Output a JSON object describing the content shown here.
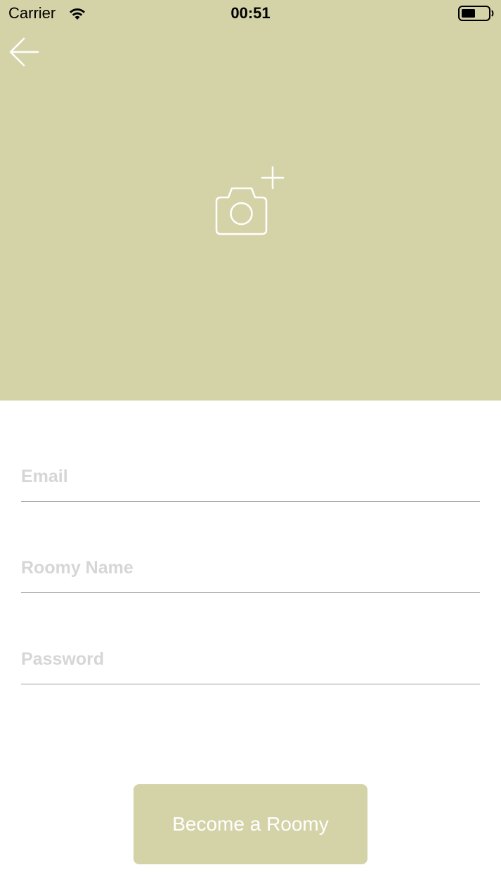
{
  "status_bar": {
    "carrier": "Carrier",
    "time": "00:51",
    "wifi_icon": "wifi-icon",
    "battery_icon": "battery-icon"
  },
  "header": {
    "background_color": "#d4d3a8",
    "back_icon": "arrow-left-icon",
    "photo_icon": "camera-plus-icon"
  },
  "form": {
    "email": {
      "placeholder": "Email",
      "value": ""
    },
    "roomy_name": {
      "placeholder": "Roomy Name",
      "value": ""
    },
    "password": {
      "placeholder": "Password",
      "value": ""
    }
  },
  "cta": {
    "label": "Become a Roomy",
    "background_color": "#d4d3a8"
  }
}
